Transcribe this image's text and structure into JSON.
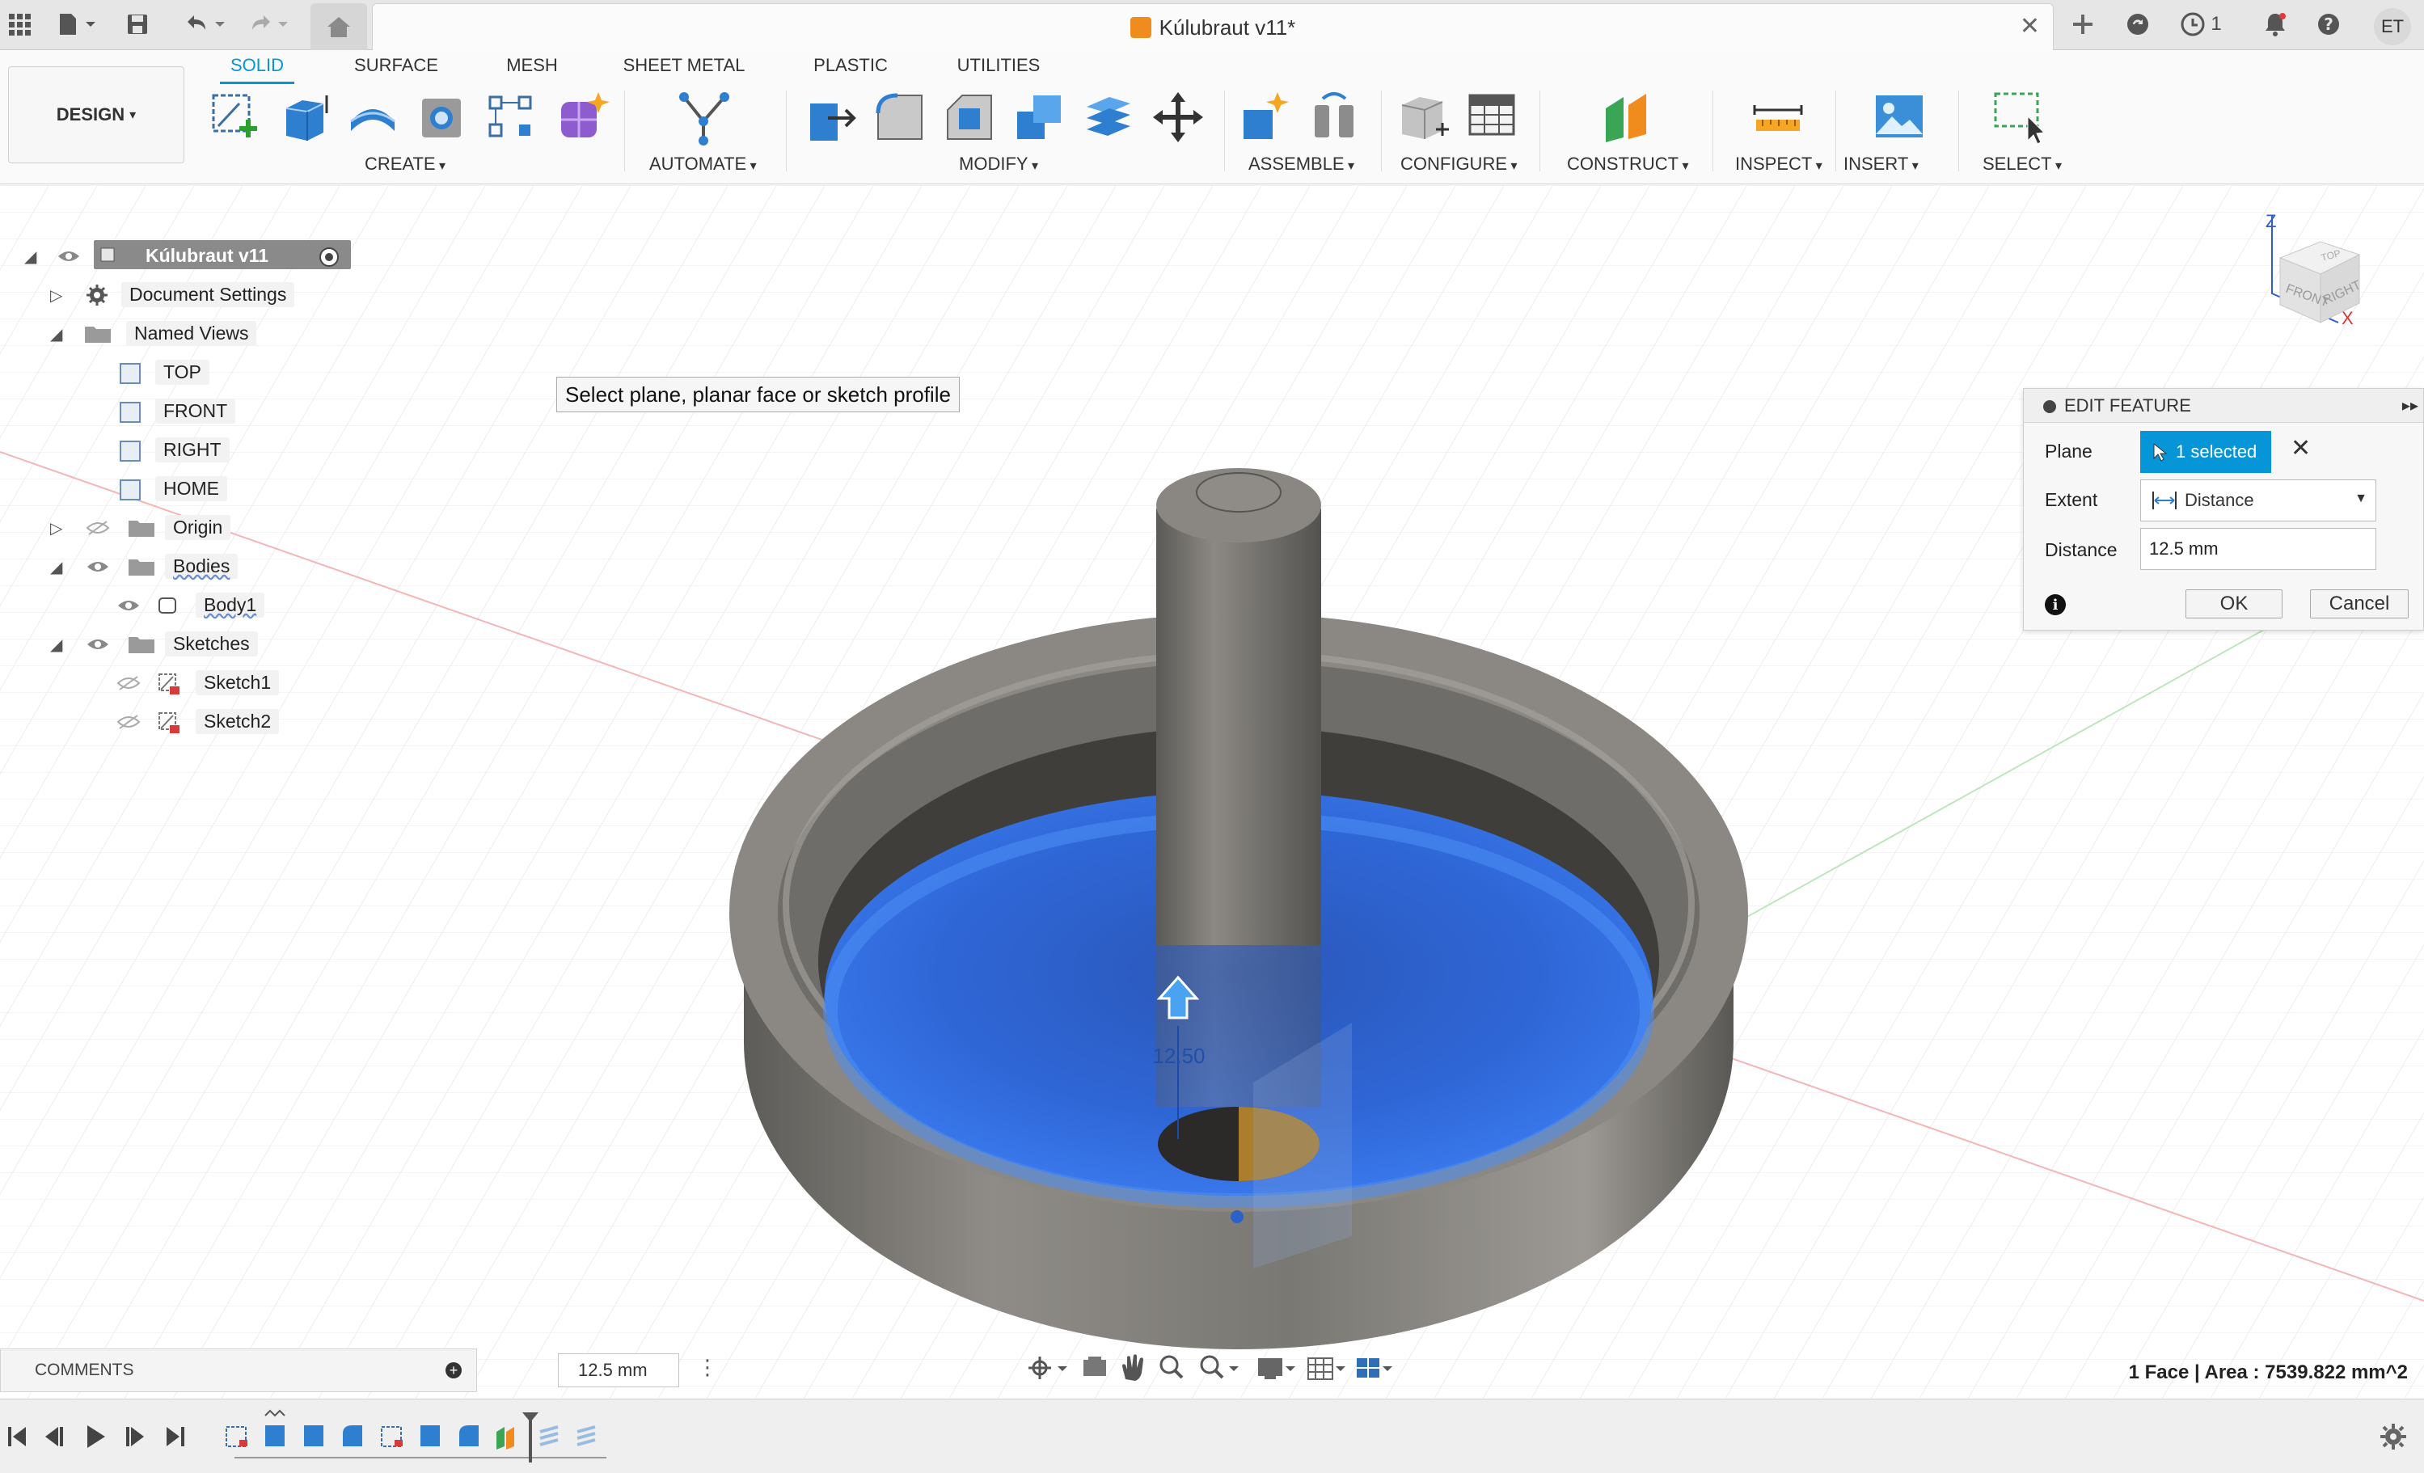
{
  "titlebar": {
    "document_title": "Kúlubraut v11*",
    "notifications_count": "1",
    "user_initials": "ET"
  },
  "toolbar": {
    "workspace_label": "DESIGN",
    "tabs": [
      "SOLID",
      "SURFACE",
      "MESH",
      "SHEET METAL",
      "PLASTIC",
      "UTILITIES"
    ],
    "active_tab": "SOLID",
    "groups": [
      "CREATE",
      "AUTOMATE",
      "MODIFY",
      "ASSEMBLE",
      "CONFIGURE",
      "CONSTRUCT",
      "INSPECT",
      "INSERT",
      "SELECT"
    ]
  },
  "browser": {
    "root": "Kúlubraut v11",
    "items": [
      {
        "label": "Document Settings",
        "icon": "gear-icon"
      },
      {
        "label": "Named Views",
        "icon": "folder-icon"
      },
      {
        "label": "TOP",
        "icon": "named-view-icon"
      },
      {
        "label": "FRONT",
        "icon": "named-view-icon"
      },
      {
        "label": "RIGHT",
        "icon": "named-view-icon"
      },
      {
        "label": "HOME",
        "icon": "named-view-icon"
      },
      {
        "label": "Origin",
        "icon": "folder-icon"
      },
      {
        "label": "Bodies",
        "icon": "folder-icon"
      },
      {
        "label": "Body1",
        "icon": "body-icon"
      },
      {
        "label": "Sketches",
        "icon": "folder-icon"
      },
      {
        "label": "Sketch1",
        "icon": "sketch-icon"
      },
      {
        "label": "Sketch2",
        "icon": "sketch-icon"
      }
    ]
  },
  "viewport": {
    "prompt": "Select plane, planar face or sketch profile",
    "dimension_label": "12.50",
    "viewcube": {
      "top": "TOP",
      "front": "FRONT",
      "right": "RIGHT",
      "axis_z": "Z",
      "axis_x": "X"
    }
  },
  "edit_feature": {
    "title": "EDIT FEATURE",
    "plane_label": "Plane",
    "plane_value": "1 selected",
    "extent_label": "Extent",
    "extent_value": "Distance",
    "distance_label": "Distance",
    "distance_value": "12.5 mm",
    "ok_label": "OK",
    "cancel_label": "Cancel"
  },
  "bottom": {
    "comments_label": "COMMENTS",
    "distance_value": "12.5 mm",
    "status_text": "1 Face | Area : 7539.822 mm^2"
  },
  "colors": {
    "accent": "#0696d7",
    "selection_blue": "#2f6de0",
    "body_gray": "#7d7b77"
  }
}
